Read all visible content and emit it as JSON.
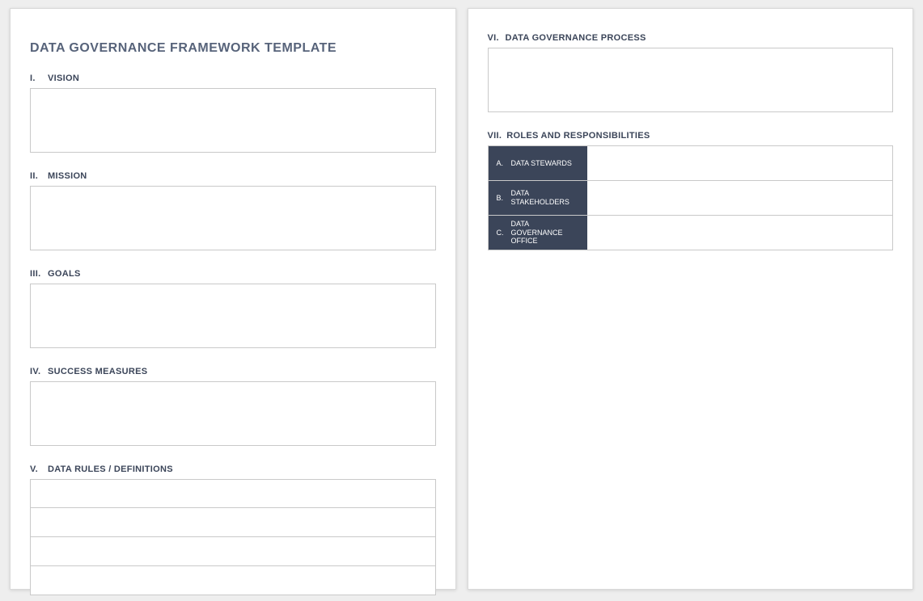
{
  "title": "DATA GOVERNANCE FRAMEWORK TEMPLATE",
  "left_sections": [
    {
      "num": "I.",
      "label": "VISION",
      "kind": "box",
      "value": ""
    },
    {
      "num": "II.",
      "label": "MISSION",
      "kind": "box",
      "value": ""
    },
    {
      "num": "III.",
      "label": "GOALS",
      "kind": "box",
      "value": ""
    },
    {
      "num": "IV.",
      "label": "SUCCESS MEASURES",
      "kind": "box",
      "value": ""
    },
    {
      "num": "V.",
      "label": "DATA RULES / DEFINITIONS",
      "kind": "rows",
      "rows": [
        "",
        "",
        "",
        ""
      ]
    }
  ],
  "right_sections": {
    "process": {
      "num": "VI.",
      "label": "DATA GOVERNANCE PROCESS",
      "value": ""
    },
    "roles_header": {
      "num": "VII.",
      "label": "ROLES AND RESPONSIBILITIES"
    },
    "roles": [
      {
        "letter": "A.",
        "label": "DATA STEWARDS",
        "value": ""
      },
      {
        "letter": "B.",
        "label": "DATA STAKEHOLDERS",
        "value": ""
      },
      {
        "letter": "C.",
        "label": "DATA GOVERNANCE OFFICE",
        "value": ""
      }
    ]
  }
}
